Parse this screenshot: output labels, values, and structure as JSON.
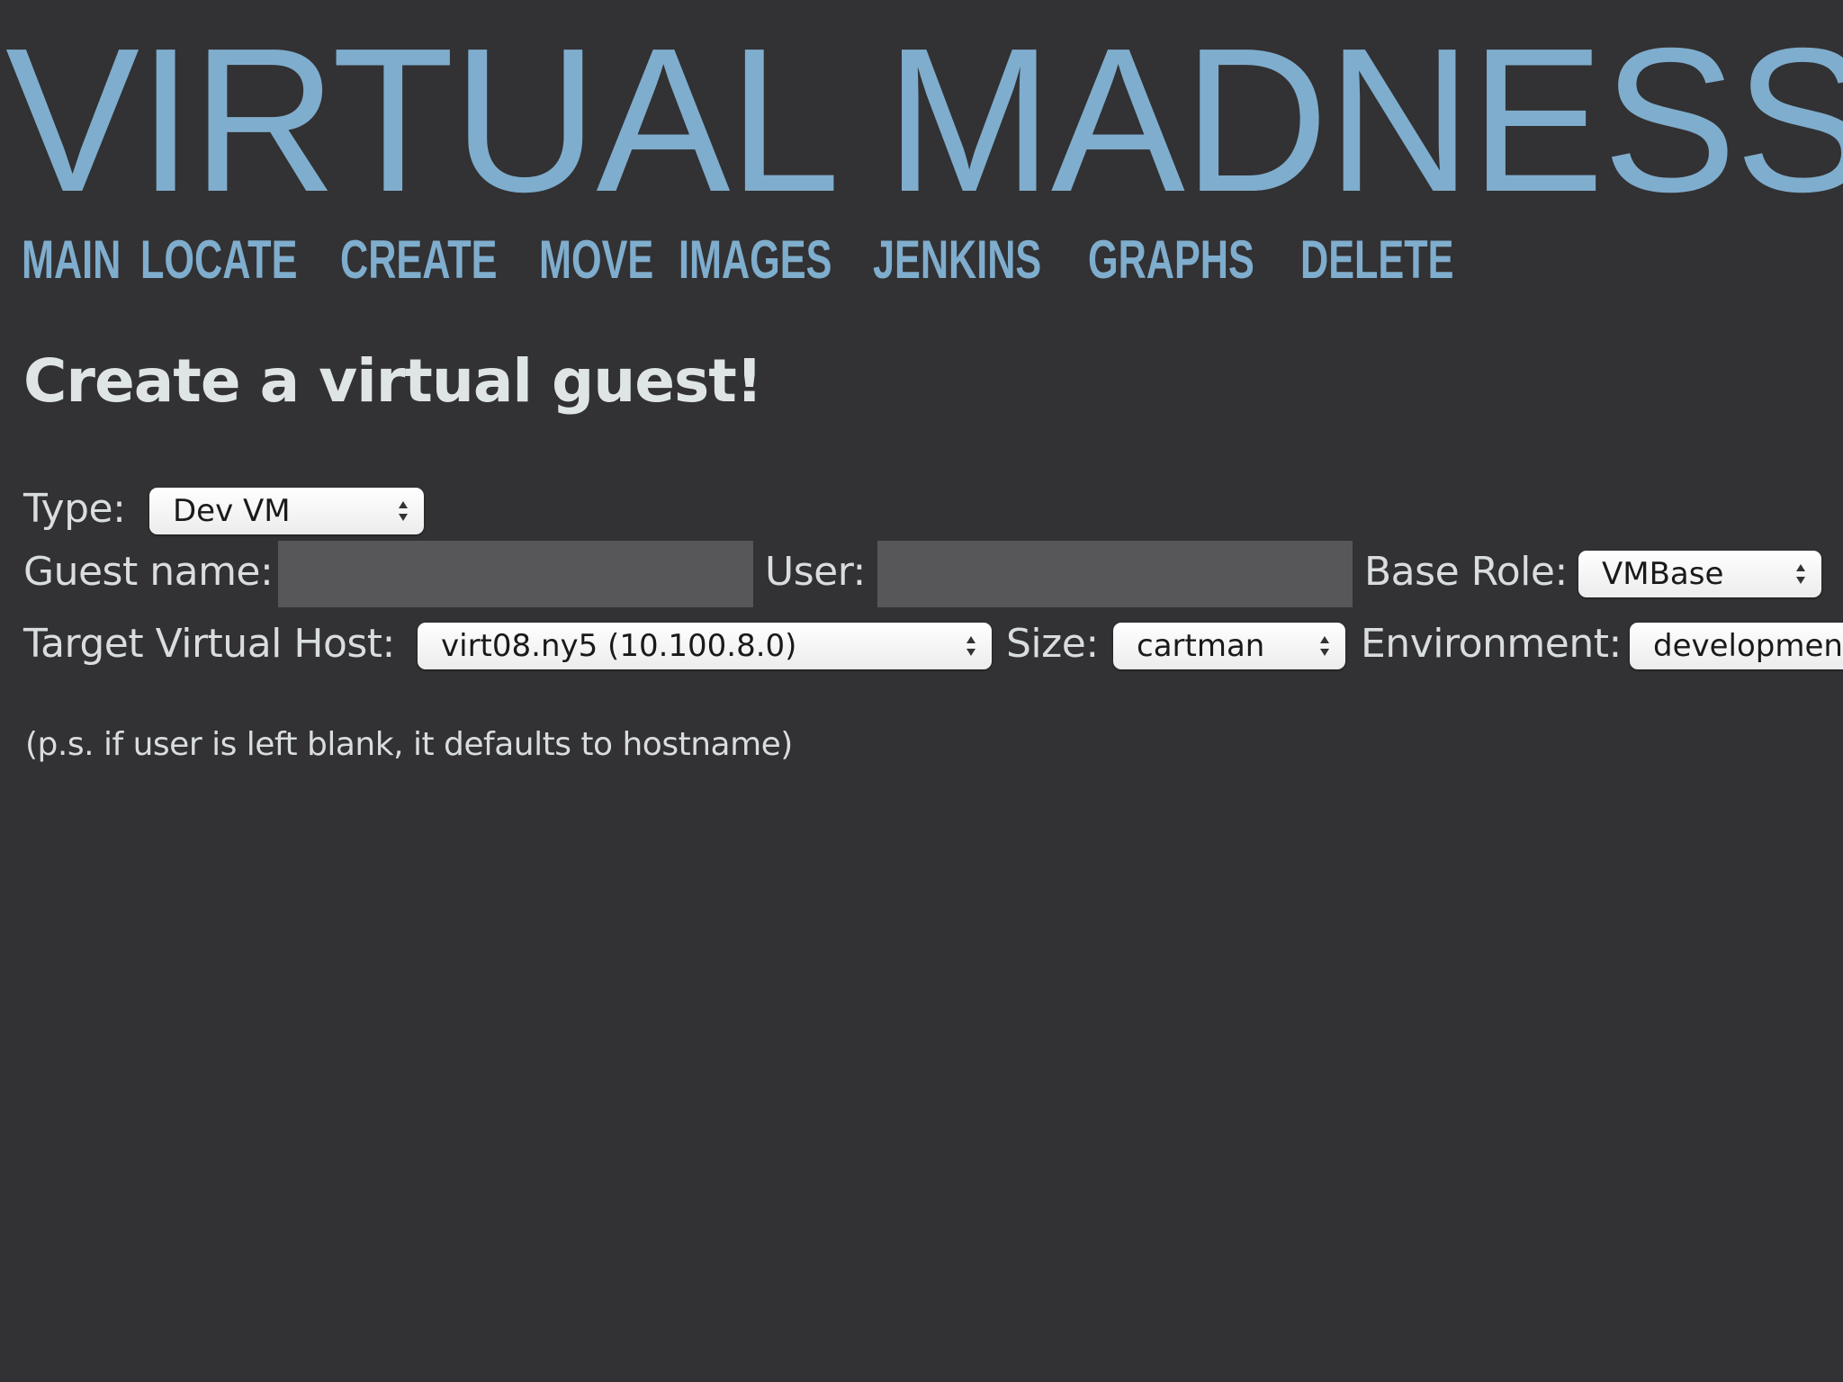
{
  "site": {
    "title": "VIRTUAL MADNESS"
  },
  "nav": {
    "items": [
      {
        "label": "MAIN"
      },
      {
        "label": "LOCATE"
      },
      {
        "label": "CREATE"
      },
      {
        "label": "MOVE"
      },
      {
        "label": "IMAGES"
      },
      {
        "label": "JENKINS"
      },
      {
        "label": "GRAPHS"
      },
      {
        "label": "DELETE"
      }
    ]
  },
  "page": {
    "heading": "Create a virtual guest!"
  },
  "form": {
    "type": {
      "label": "Type:",
      "value": "Dev VM"
    },
    "guest_name": {
      "label": "Guest name:",
      "value": "",
      "placeholder": ""
    },
    "user": {
      "label": "User:",
      "value": "",
      "placeholder": ""
    },
    "base_role": {
      "label": "Base Role:",
      "value": "VMBase"
    },
    "target_host": {
      "label": "Target Virtual Host:",
      "value": "virt08.ny5 (10.100.8.0)"
    },
    "size": {
      "label": "Size:",
      "value": "cartman"
    },
    "environment": {
      "label": "Environment:",
      "value": "development"
    },
    "note": "(p.s. if user is left blank, it defaults to hostname)"
  },
  "icons": {
    "select_arrows": "up-down-arrows-icon"
  }
}
